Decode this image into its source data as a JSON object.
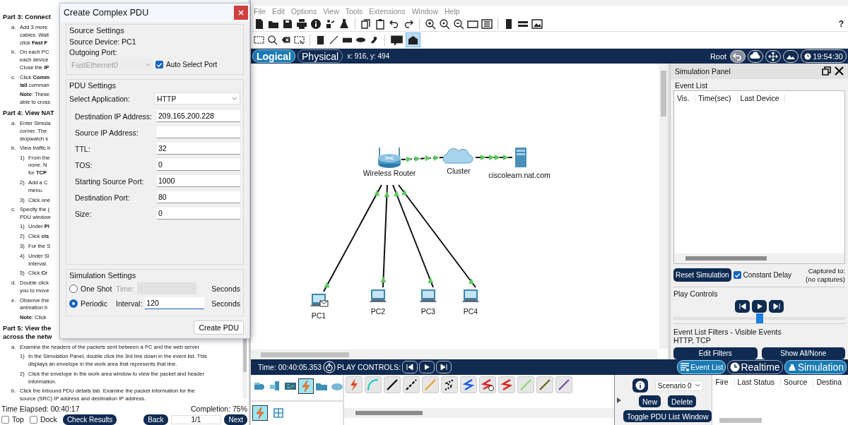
{
  "instructions": {
    "sections": [
      {
        "heading": [
          "Part 3: Connect"
        ],
        "steps": [
          {
            "kind": "step",
            "marker": "a.",
            "lines": [
              "Add 3 more",
              "cables. Wait",
              "click **Fast F**"
            ]
          },
          {
            "kind": "step",
            "marker": "b.",
            "lines": [
              "On each PC",
              "each device",
              "Close the **IP**"
            ]
          },
          {
            "kind": "step",
            "marker": "c.",
            "lines": [
              "Click **Comm**",
              "**/all** comman"
            ]
          },
          {
            "kind": "note",
            "lines": [
              "**Note**: These",
              "able to cross"
            ]
          }
        ]
      },
      {
        "heading": [
          "Part 4: View NAT"
        ],
        "steps": [
          {
            "kind": "step",
            "marker": "a.",
            "lines": [
              "Enter Simula",
              "corner. The",
              "stopwatch s"
            ]
          },
          {
            "kind": "step",
            "marker": "b.",
            "lines": [
              "View traffic b"
            ],
            "children": [
              {
                "kind": "step",
                "marker": "1)",
                "lines": [
                  "From the",
                  "none. N",
                  "for **TCP**"
                ]
              },
              {
                "kind": "step",
                "marker": "2)",
                "lines": [
                  "Add a C",
                  "menu."
                ]
              },
              {
                "kind": "step",
                "marker": "3)",
                "lines": [
                  "Click one"
                ]
              }
            ]
          },
          {
            "kind": "step",
            "marker": "c.",
            "lines": [
              "Specify the (",
              "PDU window"
            ],
            "children": [
              {
                "kind": "step",
                "marker": "1)",
                "lines": [
                  "Under **Pl**"
                ]
              },
              {
                "kind": "step",
                "marker": "2)",
                "lines": [
                  "Click **cis**"
                ]
              },
              {
                "kind": "step",
                "marker": "3)",
                "lines": [
                  "For the S"
                ]
              },
              {
                "kind": "step",
                "marker": "4)",
                "lines": [
                  "Under Si",
                  "Interval."
                ]
              },
              {
                "kind": "step",
                "marker": "5)",
                "lines": [
                  "Click **Cr**"
                ]
              }
            ]
          },
          {
            "kind": "step",
            "marker": "d.",
            "lines": [
              "Double click",
              "you to move"
            ]
          },
          {
            "kind": "step",
            "marker": "e.",
            "lines": [
              "Observe the",
              "animation b"
            ]
          },
          {
            "kind": "note",
            "lines": [
              "**Note**: Click"
            ]
          }
        ]
      },
      {
        "heading": [
          "Part 5: View the",
          "across the netw"
        ],
        "steps": [
          {
            "kind": "step",
            "marker": "a.",
            "lines": [
              "Examine the headers of the packets sent between a PC and the web server."
            ],
            "children": [
              {
                "kind": "step",
                "marker": "1)",
                "lines": [
                  "In the Simulation Panel, double click the 3rd line down in the event list. This",
                  "displays an envelope in the work area that represents that line."
                ]
              },
              {
                "kind": "step",
                "marker": "2)",
                "lines": [
                  "Click the envelope in the work area window to view the packet and header",
                  "information."
                ]
              }
            ]
          },
          {
            "kind": "step",
            "marker": "b.",
            "lines": [
              "Click the Inbound PDU details tab. Examine the packet information for the",
              "source (SRC) IP address and destination IP address."
            ]
          }
        ]
      }
    ],
    "time_elapsed": "Time Elapsed: 00:40:17",
    "completion": "Completion: 75%",
    "options": [
      {
        "label": "Top",
        "checked": false
      },
      {
        "label": "Dock",
        "checked": false
      }
    ],
    "check_button": "Check Results",
    "back_button": "Back",
    "page": "1/1",
    "next_button": "Next"
  },
  "pdu_dialog": {
    "title": "Create Complex PDU",
    "source_settings": {
      "title": "Source Settings",
      "source_device": "Source Device: PC1",
      "port_label": "Outgoing Port:",
      "port": {
        "value": "FastEthernet0",
        "disabled": true
      },
      "auto_select": {
        "label": "Auto Select Port",
        "checked": true
      }
    },
    "pdu_settings": {
      "title": "PDU Settings",
      "application_label": "Select Application:",
      "application": "HTTP",
      "fields": [
        {
          "label": "Destination IP Address:",
          "value": "209.165.200.228"
        },
        {
          "label": "Source IP Address:"
        },
        {
          "label": "TTL:",
          "value": "32"
        },
        {
          "label": "TOS:",
          "value": "0"
        },
        {
          "label": "Starting Source Port:",
          "value": "1000"
        },
        {
          "label": "Destination Port:",
          "value": "80"
        },
        {
          "label": "Size:",
          "value": "0"
        }
      ]
    },
    "simulation_settings": {
      "title": "Simulation Settings",
      "modes": [
        {
          "label": "One Shot",
          "selected": false,
          "field_label": "Time:",
          "unit": "Seconds"
        },
        {
          "label": "Periodic",
          "selected": true,
          "field_label": "Interval:",
          "value": "120",
          "unit": "Seconds"
        }
      ]
    },
    "create_button": "Create PDU"
  },
  "menu": [
    "File",
    "Edit",
    "Options",
    "View",
    "Tools",
    "Extensions",
    "Window",
    "Help"
  ],
  "help": "?",
  "pdu_tools": [
    {
      "kind": "simple_pdu",
      "selected": false
    },
    {
      "kind": "complex_pdu",
      "selected": true
    }
  ],
  "view_tabs": [
    {
      "label": "Logical",
      "selected": true
    },
    {
      "label": "Physical",
      "selected": false
    }
  ],
  "cursor_position": "x: 916, y: 494",
  "root_label": "Root",
  "clock": "19:54:30",
  "topology": {
    "devices": [
      {
        "kind": "router",
        "name": "Wireless Router",
        "pdu": false
      },
      {
        "kind": "cloud",
        "name": "Cluster",
        "pdu": false
      },
      {
        "kind": "server",
        "name": "ciscolearn.nat.com",
        "pdu": false
      },
      {
        "kind": "pc",
        "name": "PC1",
        "pdu": true
      },
      {
        "kind": "pc",
        "name": "PC2",
        "pdu": false
      },
      {
        "kind": "pc",
        "name": "PC3",
        "pdu": false
      },
      {
        "kind": "pc",
        "name": "PC4",
        "pdu": false
      }
    ]
  },
  "simulation_panel": {
    "title": "Simulation Panel",
    "event_list_label": "Event List",
    "columns": [
      "Vis.",
      "Time(sec)",
      "Last Device"
    ],
    "reset_button": "Reset Simulation",
    "constant_delay": {
      "label": "Constant Delay",
      "checked": true
    },
    "captured_label": "Captured to:",
    "captured_value": "(no captures)",
    "play_controls_label": "Play Controls",
    "playback": {
      "level": 0.5
    },
    "filters_label": "Event List Filters - Visible Events",
    "filters_value": "HTTP, TCP",
    "edit_filters_button": "Edit Filters",
    "show_all_button": "Show All/None"
  },
  "bottom_bar": {
    "time": "Time: 00:40:05.353",
    "play_label": "PLAY CONTROLS:",
    "event_list_toggle": {
      "label": "Event List",
      "on": true
    },
    "modes": [
      {
        "label": "Realtime",
        "selected": false
      },
      {
        "label": "Simulation",
        "selected": true
      }
    ]
  },
  "device_categories": [
    {
      "kind": "network",
      "selected": false
    },
    {
      "kind": "end",
      "selected": false
    },
    {
      "kind": "component",
      "selected": false
    },
    {
      "kind": "connection",
      "selected": true
    },
    {
      "kind": "misc",
      "selected": false
    },
    {
      "kind": "multiuser",
      "selected": false
    }
  ],
  "device_subcategories": [
    {
      "kind": "connection",
      "selected": true
    },
    {
      "kind": "grid",
      "selected": false
    }
  ],
  "cables": [
    {
      "kind": "auto",
      "color": "#e8401c"
    },
    {
      "kind": "curve",
      "color": "#33cccc"
    },
    {
      "kind": "line",
      "color": "#111111"
    },
    {
      "kind": "dashed",
      "color": "#111111"
    },
    {
      "kind": "line",
      "color": "#f0a030"
    },
    {
      "kind": "dotted",
      "color": "#111111"
    },
    {
      "kind": "bolt",
      "color": "#1a5ce6"
    },
    {
      "kind": "bolt-clock",
      "color": "#e02020"
    },
    {
      "kind": "bolt",
      "color": "#e02020"
    },
    {
      "kind": "line",
      "color": "#88dd66"
    },
    {
      "kind": "line",
      "color": "#6b6b20"
    },
    {
      "kind": "line",
      "color": "#7b4fb0"
    }
  ],
  "pdu_list": {
    "scenario": "Scenario 0",
    "new_button": "New",
    "delete_button": "Delete",
    "toggle_button": "Toggle PDU List Window",
    "columns": [
      "Fire",
      "Last Status",
      "Source",
      "Destina"
    ]
  }
}
